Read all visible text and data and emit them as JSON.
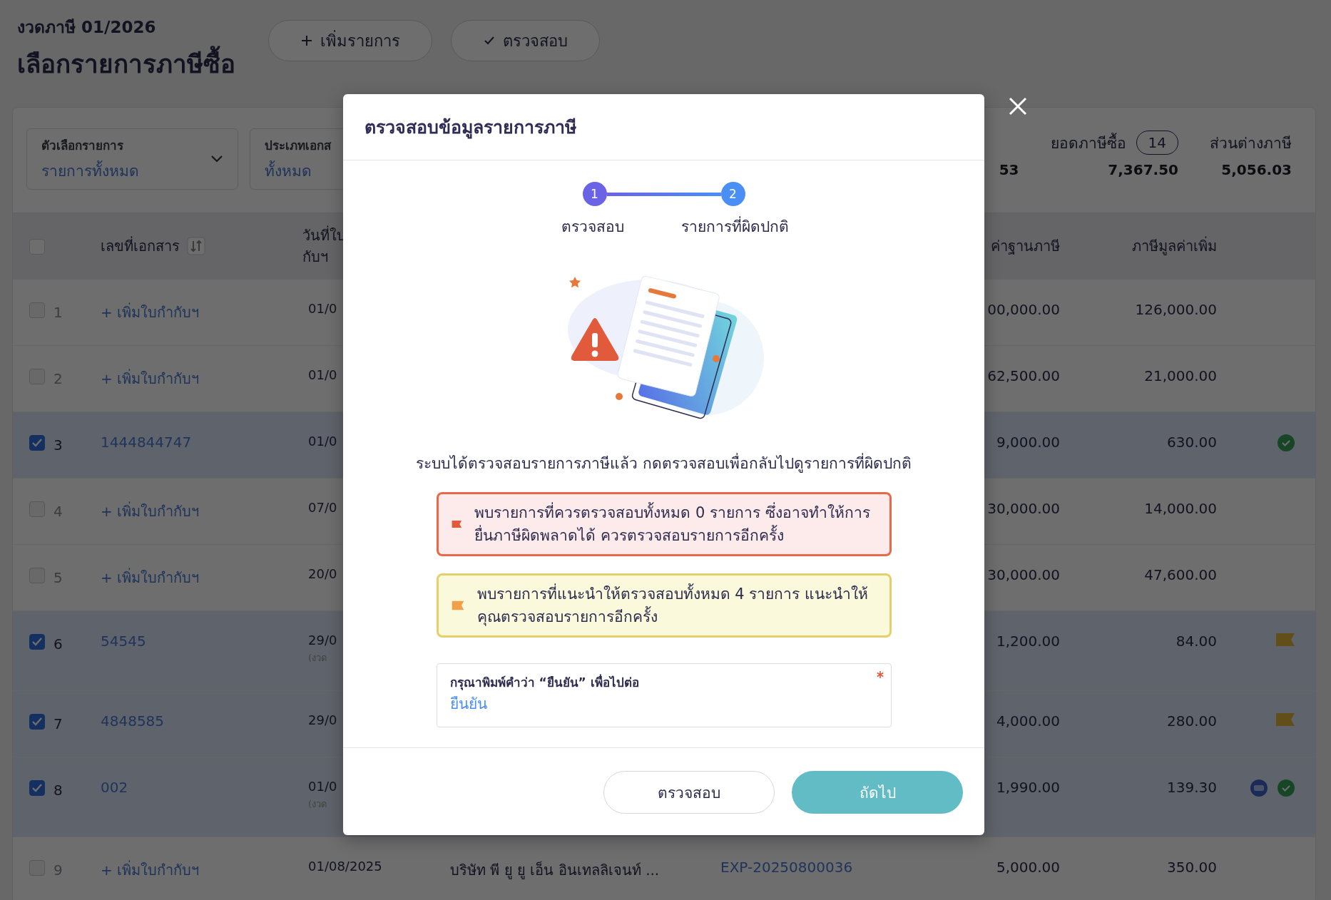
{
  "header": {
    "period": "งวดภาษี 01/2026",
    "title": "เลือกรายการภาษีซื้อ",
    "buttons": [
      {
        "kind": "add",
        "label": "เพิ่มรายการ"
      },
      {
        "kind": "check",
        "label": "ตรวจสอบ"
      }
    ]
  },
  "filters": [
    {
      "label": "ตัวเลือกรายการ",
      "value": "รายการทั้งหมด",
      "dropdown": true
    },
    {
      "label": "ประเภทเอกส",
      "value": "ทั้งหมด",
      "dropdown": false
    }
  ],
  "summary": [
    {
      "value": "53"
    },
    {
      "label": "ยอดภาษีซื้อ",
      "badge": "14",
      "value": "7,367.50"
    },
    {
      "label": "ส่วนต่างภาษี",
      "value": "5,056.03"
    }
  ],
  "table": {
    "select_all": {
      "checked": false
    },
    "columns": [
      {
        "kind": "doc",
        "label": "เลขที่เอกสาร",
        "sortable": true
      },
      {
        "kind": "date",
        "lines": [
          "วันที่ใบ",
          "กับฯ"
        ]
      },
      {
        "kind": "base",
        "label": "ค่าฐานภาษี"
      },
      {
        "kind": "vat",
        "label": "ภาษีมูลค่าเพิ่ม"
      }
    ],
    "rows": [
      {
        "no": "1",
        "checked": false,
        "doc": "+ เพิ่มใบกำกับฯ",
        "date": "01/0",
        "base": "00,000.00",
        "vat": "126,000.00",
        "verified": false,
        "flagged": false,
        "tax_invoice": false
      },
      {
        "no": "2",
        "checked": false,
        "doc": "+ เพิ่มใบกำกับฯ",
        "date": "01/0",
        "base": "62,500.00",
        "vat": "21,000.00",
        "verified": false,
        "flagged": false,
        "tax_invoice": false
      },
      {
        "no": "3",
        "checked": true,
        "doc": "1444844747",
        "date": "01/0",
        "base": "9,000.00",
        "vat": "630.00",
        "verified": true,
        "flagged": false,
        "tax_invoice": false
      },
      {
        "no": "4",
        "checked": false,
        "doc": "+ เพิ่มใบกำกับฯ",
        "date": "07/0",
        "base": "30,000.00",
        "vat": "14,000.00",
        "verified": false,
        "flagged": false,
        "tax_invoice": false
      },
      {
        "no": "5",
        "checked": false,
        "doc": "+ เพิ่มใบกำกับฯ",
        "date": "20/0",
        "base": "30,000.00",
        "vat": "47,600.00",
        "verified": false,
        "flagged": false,
        "tax_invoice": false
      },
      {
        "no": "6",
        "checked": true,
        "doc": "54545",
        "date": "29/0",
        "date_note": "(งวด",
        "base": "1,200.00",
        "vat": "84.00",
        "verified": false,
        "flagged": true,
        "tax_invoice": false
      },
      {
        "no": "7",
        "checked": true,
        "doc": "4848585",
        "date": "29/0",
        "base": "4,000.00",
        "vat": "280.00",
        "verified": false,
        "flagged": true,
        "tax_invoice": false
      },
      {
        "no": "8",
        "checked": true,
        "doc": "002",
        "date": "01/0",
        "date_note": "(งวด",
        "base": "1,990.00",
        "vat": "139.30",
        "verified": true,
        "flagged": false,
        "tax_invoice": true
      },
      {
        "no": "9",
        "checked": false,
        "doc": "+ เพิ่มใบกำกับฯ",
        "date": "01/08/2025",
        "company": "บริษัท พี ยู ยู เอ็น อินเทลลิเจนท์ ...",
        "ref": "EXP-20250800036",
        "base": "5,000.00",
        "vat": "350.00",
        "verified": false,
        "flagged": false,
        "tax_invoice": false
      }
    ]
  },
  "modal": {
    "title": "ตรวจสอบข้อมูลรายการภาษี",
    "steps": [
      {
        "number": "1",
        "label": "ตรวจสอบ",
        "color": "#6b63e6"
      },
      {
        "number": "2",
        "label": "รายการที่ผิดปกติ",
        "color": "#4a8ff5"
      }
    ],
    "message": "ระบบได้ตรวจสอบรายการภาษีแล้ว กดตรวจสอบเพื่อกลับไปดูรายการที่ผิดปกติ",
    "alerts": [
      {
        "kind": "error",
        "text": "พบรายการที่ควรตรวจสอบทั้งหมด 0 รายการ ซึ่งอาจทำให้การยื่นภาษีผิดพลาดได้ ควรตรวจสอบรายการอีกครั้ง"
      },
      {
        "kind": "warning",
        "text": "พบรายการที่แนะนำให้ตรวจสอบทั้งหมด 4 รายการ แนะนำให้คุณตรวจสอบรายการอีกครั้ง"
      }
    ],
    "confirm_field": {
      "label": "กรุณาพิมพ์คำว่า “ยืนยัน” เพื่อไปต่อ",
      "value": "ยืนยัน",
      "required": true
    },
    "buttons": [
      {
        "kind": "secondary",
        "label": "ตรวจสอบ"
      },
      {
        "kind": "primary",
        "label": "ถัดไป"
      }
    ]
  }
}
